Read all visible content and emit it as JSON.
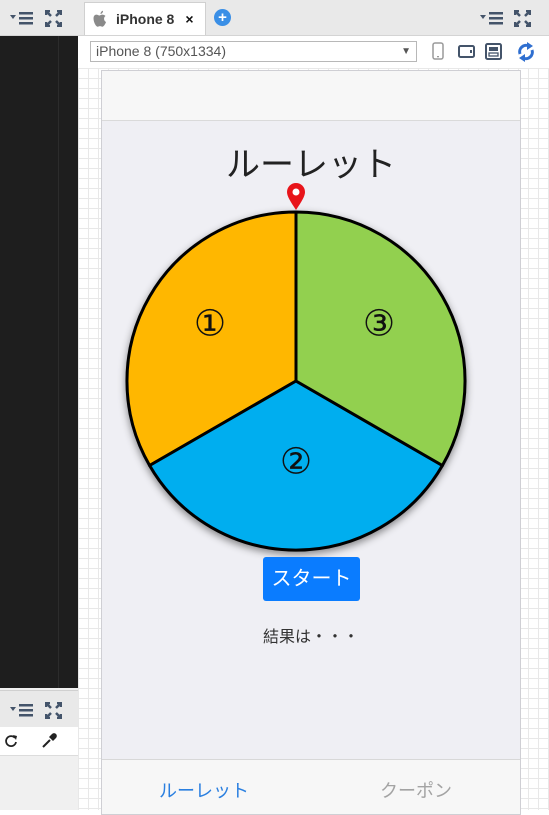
{
  "device_tab": {
    "label": "iPhone 8",
    "close": "×",
    "add": "+"
  },
  "device_select": {
    "value": "iPhone 8 (750x1334)"
  },
  "app": {
    "title": "ルーレット",
    "segments": [
      {
        "label": "①",
        "color": "#ffb700"
      },
      {
        "label": "②",
        "color": "#00aeef"
      },
      {
        "label": "③",
        "color": "#92d050"
      }
    ],
    "pointer_color": "#e8141a",
    "start_button": "スタート",
    "result": "結果は・・・",
    "tabs": [
      {
        "label": "ルーレット",
        "active": true
      },
      {
        "label": "クーポン",
        "active": false
      }
    ]
  },
  "colors": {
    "accent": "#0a7cff",
    "highlight": "#e8141a",
    "dark_panel": "#1e1e1e"
  }
}
